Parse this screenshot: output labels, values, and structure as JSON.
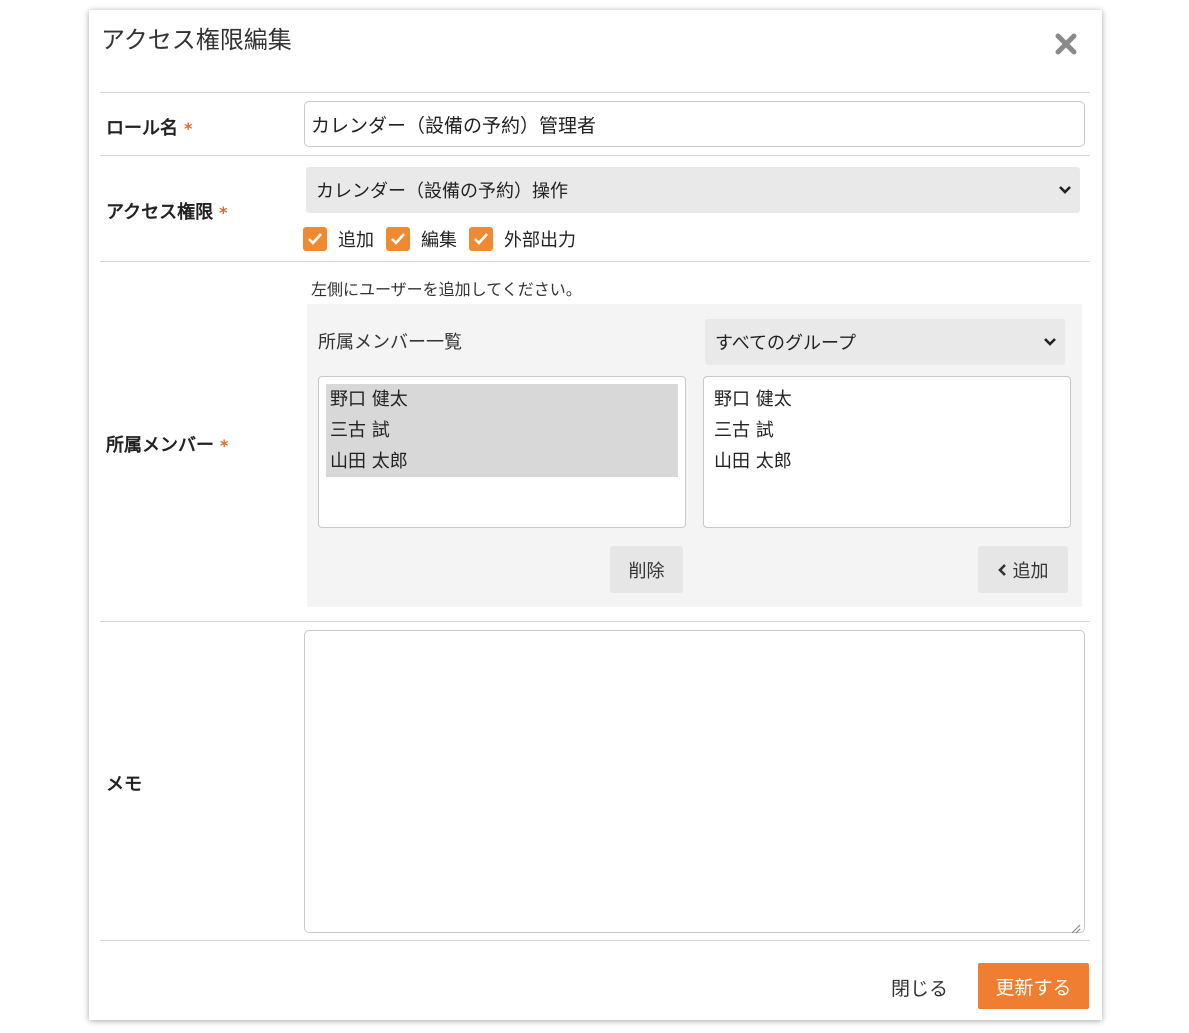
{
  "dialog": {
    "title": "アクセス権限編集",
    "close_icon": "close-icon"
  },
  "form": {
    "role_name": {
      "label": "ロール名",
      "required_mark": "*",
      "value": "カレンダー（設備の予約）管理者"
    },
    "access": {
      "label": "アクセス権限",
      "required_mark": "*",
      "selected": "カレンダー（設備の予約）操作",
      "checkboxes": [
        {
          "label": "追加",
          "checked": true
        },
        {
          "label": "編集",
          "checked": true
        },
        {
          "label": "外部出力",
          "checked": true
        }
      ]
    },
    "members": {
      "label": "所属メンバー",
      "required_mark": "*",
      "hint": "左側にユーザーを追加してください。",
      "panel_title": "所属メンバー一覧",
      "group_select": "すべてのグループ",
      "assigned": [
        "野口 健太",
        "三古 試",
        "山田 太郎"
      ],
      "available": [
        "野口 健太",
        "三古 試",
        "山田 太郎"
      ],
      "remove_label": "削除",
      "add_label": "追加"
    },
    "memo": {
      "label": "メモ",
      "value": ""
    }
  },
  "footer": {
    "close_label": "閉じる",
    "submit_label": "更新する"
  },
  "colors": {
    "accent": "#ef7e32",
    "required": "#e8662a"
  }
}
